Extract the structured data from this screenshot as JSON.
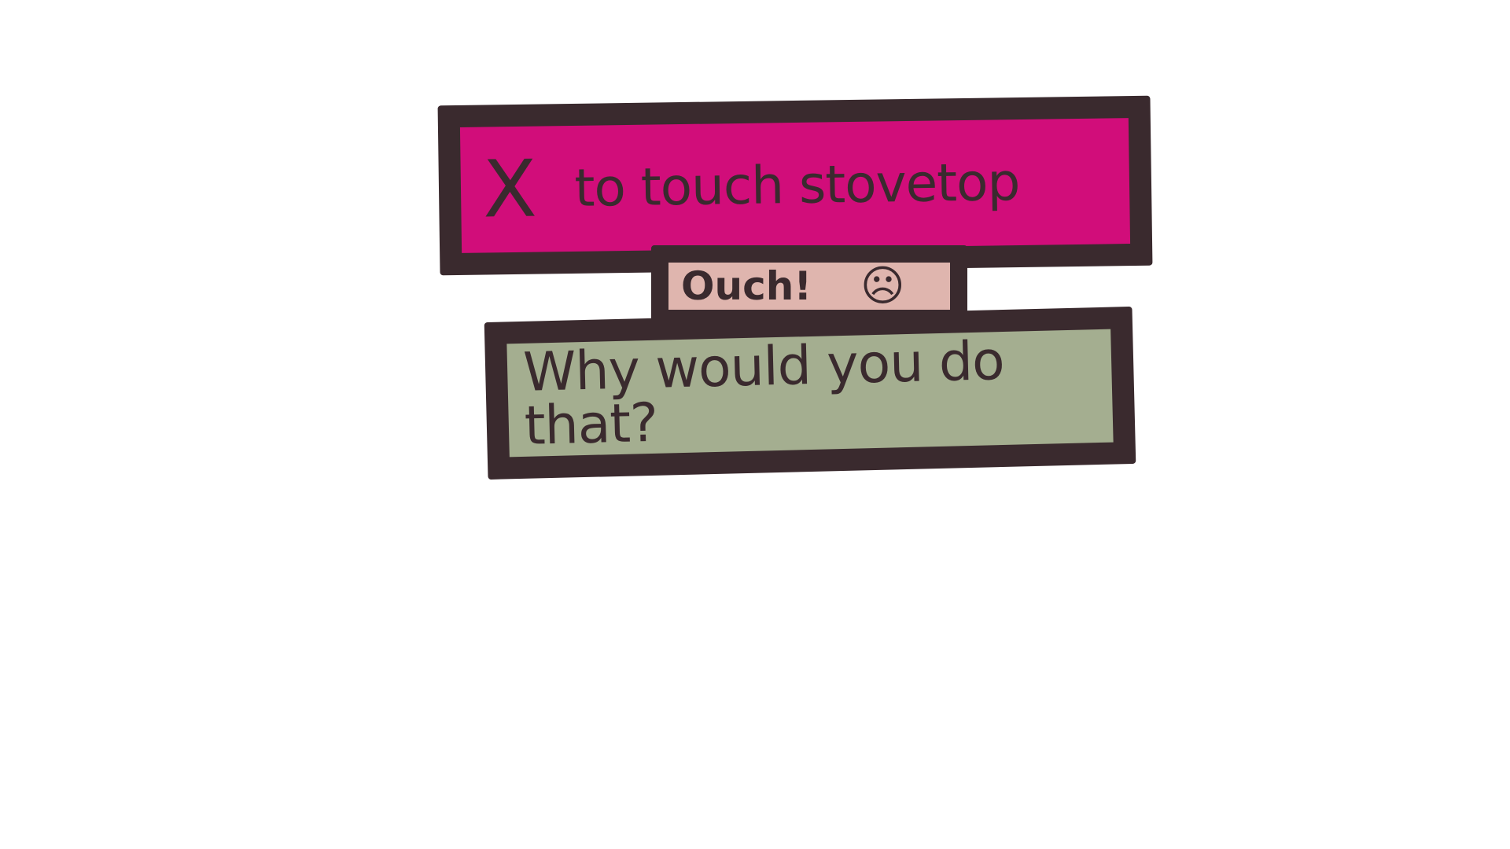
{
  "prompt": {
    "key": "X",
    "label": "to touch stovetop",
    "color": "#d10d7a"
  },
  "response": {
    "exclaim": "Ouch!",
    "face": "☹",
    "color": "#dfb5ae"
  },
  "followup": {
    "question": "Why would you do that?",
    "color": "#a4ae90"
  },
  "colors": {
    "outline": "#3a2a2e",
    "background": "#ffffff"
  }
}
